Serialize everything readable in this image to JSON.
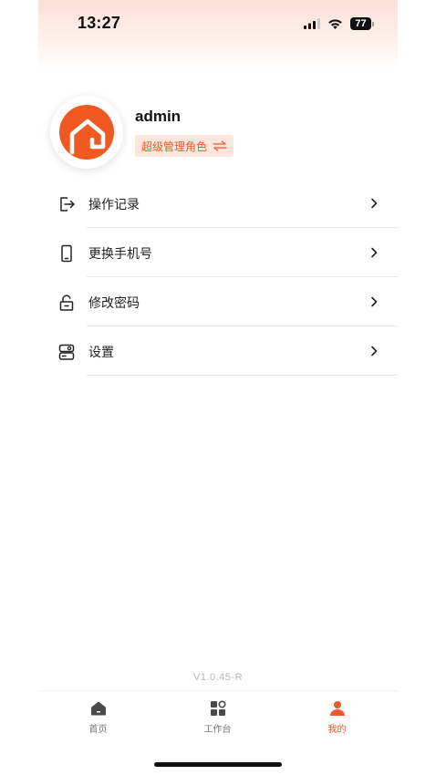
{
  "status_bar": {
    "time": "13:27",
    "battery": "77"
  },
  "profile": {
    "username": "admin",
    "role": "超级管理角色"
  },
  "menu": {
    "items": [
      {
        "label": "操作记录",
        "icon": "logout-icon"
      },
      {
        "label": "更换手机号",
        "icon": "phone-icon"
      },
      {
        "label": "修改密码",
        "icon": "lock-icon"
      },
      {
        "label": "设置",
        "icon": "settings-icon"
      }
    ]
  },
  "version": "V1.0.45-R",
  "tabbar": {
    "items": [
      {
        "label": "首页",
        "icon": "home-icon"
      },
      {
        "label": "工作台",
        "icon": "workbench-icon"
      },
      {
        "label": "我的",
        "icon": "user-icon",
        "active": true
      }
    ]
  },
  "colors": {
    "accent": "#e9592a",
    "brand": "#f05a22"
  }
}
